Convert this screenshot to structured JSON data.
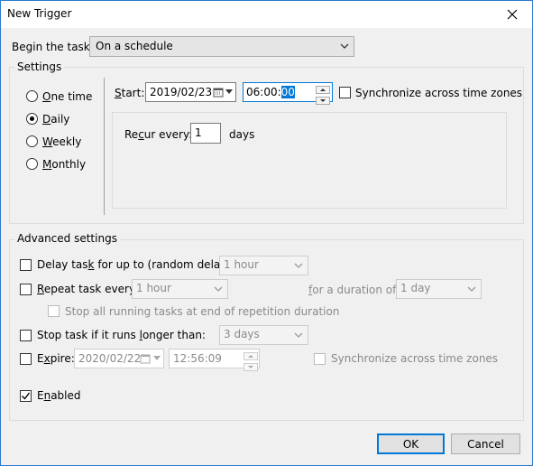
{
  "window": {
    "title": "New Trigger"
  },
  "begin": {
    "label": "Begin the task:",
    "value": "On a schedule"
  },
  "settings": {
    "legend": "Settings",
    "schedule": [
      {
        "label": "One time",
        "selected": false
      },
      {
        "label": "Daily",
        "selected": true
      },
      {
        "label": "Weekly",
        "selected": false
      },
      {
        "label": "Monthly",
        "selected": false
      }
    ],
    "start_label": "Start:",
    "start_date": "2019/02/23",
    "start_time_prefix": "06:00:",
    "start_time_selected": "00",
    "sync_label": "Synchronize across time zones",
    "sync_checked": false,
    "recur_label": "Recur every:",
    "recur_value": "1",
    "recur_unit": "days"
  },
  "advanced": {
    "legend": "Advanced settings",
    "delay_label": "Delay task for up to (random delay):",
    "delay_value": "1 hour",
    "repeat_label": "Repeat task every:",
    "repeat_value": "1 hour",
    "duration_label": "for a duration of:",
    "duration_value": "1 day",
    "stop_all_label": "Stop all running tasks at end of repetition duration",
    "stop_if_label": "Stop task if it runs longer than:",
    "stop_if_value": "3 days",
    "expire_label": "Expire:",
    "expire_date": "2020/02/22",
    "expire_time": "12:56:09",
    "expire_sync_label": "Synchronize across time zones",
    "enabled_label": "Enabled",
    "enabled_checked": true
  },
  "buttons": {
    "ok": "OK",
    "cancel": "Cancel"
  }
}
